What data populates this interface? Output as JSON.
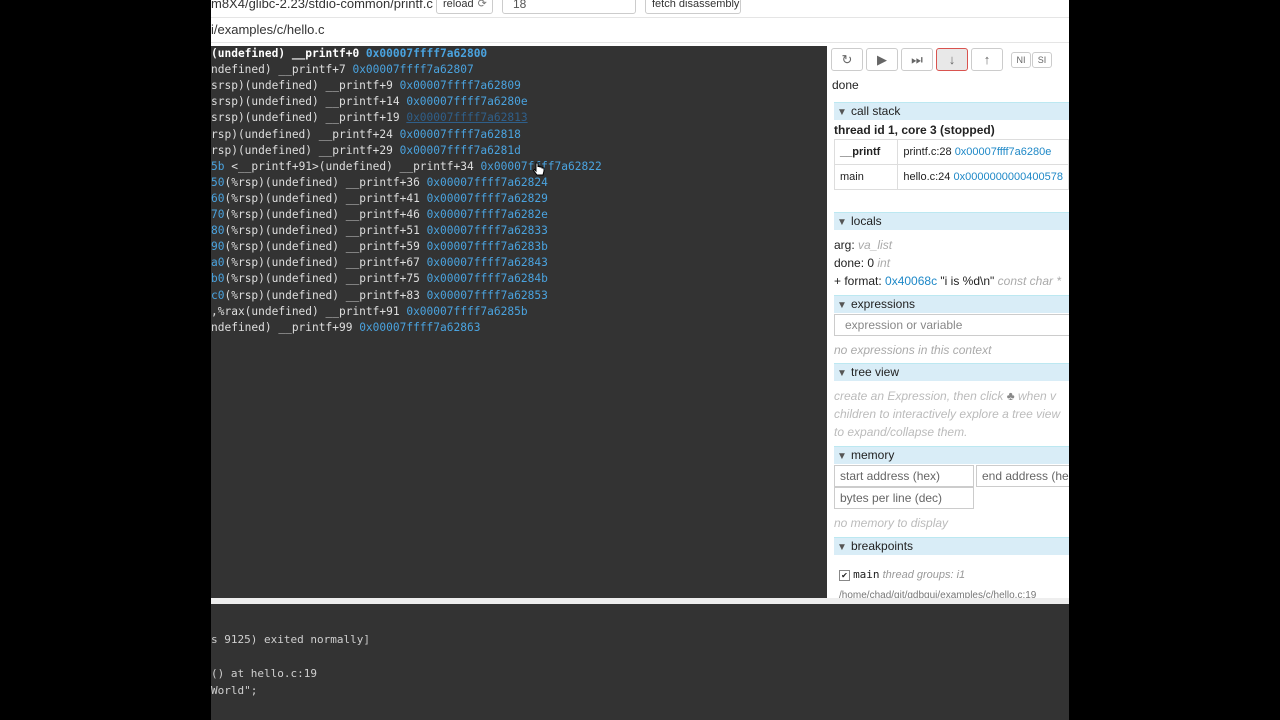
{
  "toolbar": {
    "path_fragment": "m8X4/glibc-2.23/stdio-common/printf.c",
    "reload_label": "reload",
    "line_value": "18",
    "fetch_label": "fetch disassembly"
  },
  "file_path": "i/examples/c/hello.c",
  "disassembly": [
    {
      "prefix": "",
      "text": "(undefined) __printf+0 ",
      "addr": "0x00007ffff7a62800",
      "current": true
    },
    {
      "prefix": "",
      "text": "ndefined) __printf+7 ",
      "addr": "0x00007ffff7a62807"
    },
    {
      "prefix": "",
      "text": "srsp)(undefined) __printf+9 ",
      "addr": "0x00007ffff7a62809"
    },
    {
      "prefix": "",
      "text": "srsp)(undefined) __printf+14 ",
      "addr": "0x00007ffff7a6280e"
    },
    {
      "prefix": "",
      "text": "srsp)(undefined) __printf+19 ",
      "addr": "0x00007ffff7a62813",
      "hover": true
    },
    {
      "prefix": "",
      "text": "rsp)(undefined) __printf+24 ",
      "addr": "0x00007ffff7a62818"
    },
    {
      "prefix": "",
      "text": "rsp)(undefined) __printf+29 ",
      "addr": "0x00007ffff7a6281d"
    },
    {
      "prefix": "5b",
      "text": " <__printf+91>(undefined) __printf+34 ",
      "addr": "0x00007ffff7a62822"
    },
    {
      "prefix": "50",
      "text": "(%rsp)(undefined) __printf+36 ",
      "addr": "0x00007ffff7a62824"
    },
    {
      "prefix": "60",
      "text": "(%rsp)(undefined) __printf+41 ",
      "addr": "0x00007ffff7a62829"
    },
    {
      "prefix": "70",
      "text": "(%rsp)(undefined) __printf+46 ",
      "addr": "0x00007ffff7a6282e"
    },
    {
      "prefix": "80",
      "text": "(%rsp)(undefined) __printf+51 ",
      "addr": "0x00007ffff7a62833"
    },
    {
      "prefix": "90",
      "text": "(%rsp)(undefined) __printf+59 ",
      "addr": "0x00007ffff7a6283b"
    },
    {
      "prefix": "a0",
      "text": "(%rsp)(undefined) __printf+67 ",
      "addr": "0x00007ffff7a62843"
    },
    {
      "prefix": "b0",
      "text": "(%rsp)(undefined) __printf+75 ",
      "addr": "0x00007ffff7a6284b"
    },
    {
      "prefix": "c0",
      "text": "(%rsp)(undefined) __printf+83 ",
      "addr": "0x00007ffff7a62853"
    },
    {
      "prefix": "",
      "text": ",%rax(undefined) __printf+91 ",
      "addr": "0x00007ffff7a6285b"
    },
    {
      "prefix": "",
      "text": "ndefined) __printf+99 ",
      "addr": "0x00007ffff7a62863"
    }
  ],
  "controls": {
    "ni_label": "NI",
    "si_label": "SI",
    "status": "done"
  },
  "call_stack": {
    "title": "call stack",
    "thread": "thread id 1, core 3 (stopped)",
    "frames": [
      {
        "fn": "__printf",
        "loc": "printf.c:28 ",
        "addr": "0x00007ffff7a6280e"
      },
      {
        "fn": "main",
        "loc": "hello.c:24 ",
        "addr": "0x0000000000400578"
      }
    ]
  },
  "locals": {
    "title": "locals",
    "arg_label": "arg:",
    "arg_type": "va_list",
    "done_label": "done: 0",
    "done_type": "int",
    "format_label": "+ format: ",
    "format_addr": "0x40068c",
    "format_value": " \"i is %d\\n\"",
    "format_type": "const char *"
  },
  "expressions": {
    "title": "expressions",
    "placeholder": "expression or variable",
    "empty": "no expressions in this context"
  },
  "tree_view": {
    "title": "tree view",
    "line1a": "create an Expression, then click ",
    "line1b": " when v",
    "line2": "children to interactively explore a tree view",
    "line3": "to expand/collapse them."
  },
  "memory": {
    "title": "memory",
    "start_placeholder": "start address (hex)",
    "end_placeholder": "end address (hex)",
    "bytes_placeholder": "bytes per line (dec)",
    "empty": "no memory to display"
  },
  "breakpoints": {
    "title": "breakpoints",
    "name": "main",
    "groups": "thread groups: i1",
    "path": "/home/chad/git/gdbgui/examples/c/hello.c:19"
  },
  "console": [
    "s 9125) exited normally]",
    "",
    " () at hello.c:19",
    "World\";"
  ]
}
